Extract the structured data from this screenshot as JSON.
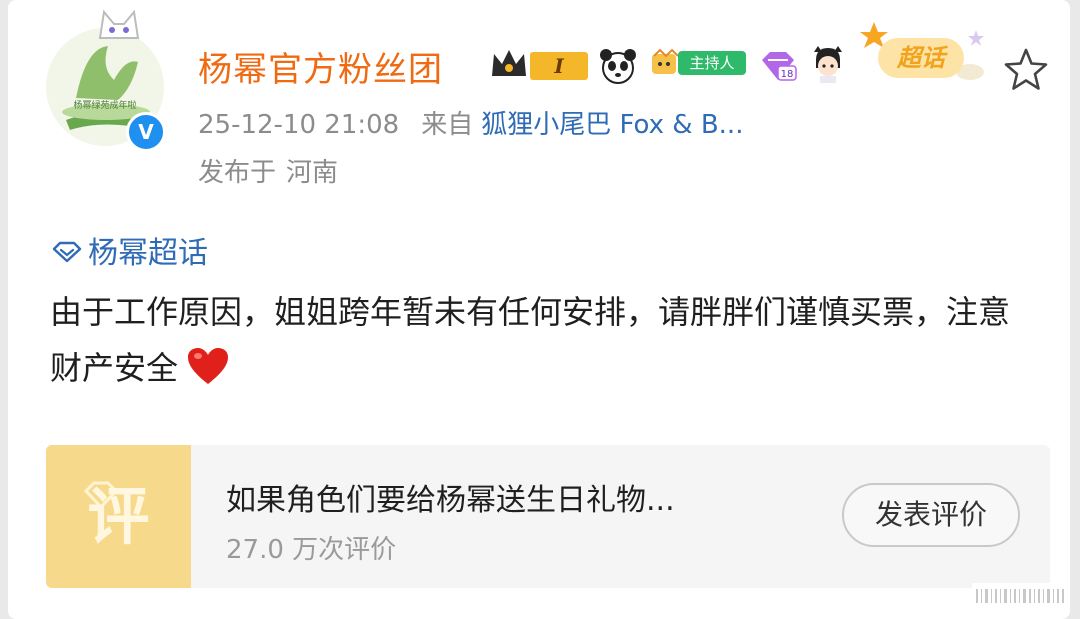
{
  "account": {
    "name": "杨幂官方粉丝团",
    "avatar_text": "杨幂绿苑成年啦",
    "level": "I",
    "host_badge": "主持人",
    "diamond_level": "18",
    "super_topic_badge": "超话",
    "verified_mark": "V"
  },
  "post_meta": {
    "timestamp": "25-12-10 21:08",
    "source_prefix": "来自",
    "source_app": "狐狸小尾巴 Fox & B...",
    "location_prefix": "发布于",
    "location": "河南"
  },
  "post": {
    "topic": "杨幂超话",
    "text": "由于工作原因，姐姐跨年暂未有任何安排，请胖胖们谨慎买票，注意财产安全"
  },
  "review_card": {
    "icon_char": "评",
    "title": "如果角色们要给杨幂送生日礼物...",
    "count": "27.0 万次评价",
    "button": "发表评价"
  },
  "colors": {
    "name_orange": "#f06a12",
    "link_blue": "#2f6cb5",
    "review_icon_bg": "#f7d98c",
    "host_green": "#2fb96a",
    "level_gold": "#f3b729"
  },
  "icons": {
    "favorite": "star-outline-icon",
    "topic": "super-topic-diamond-icon",
    "emoji": "red-heart-icon"
  }
}
